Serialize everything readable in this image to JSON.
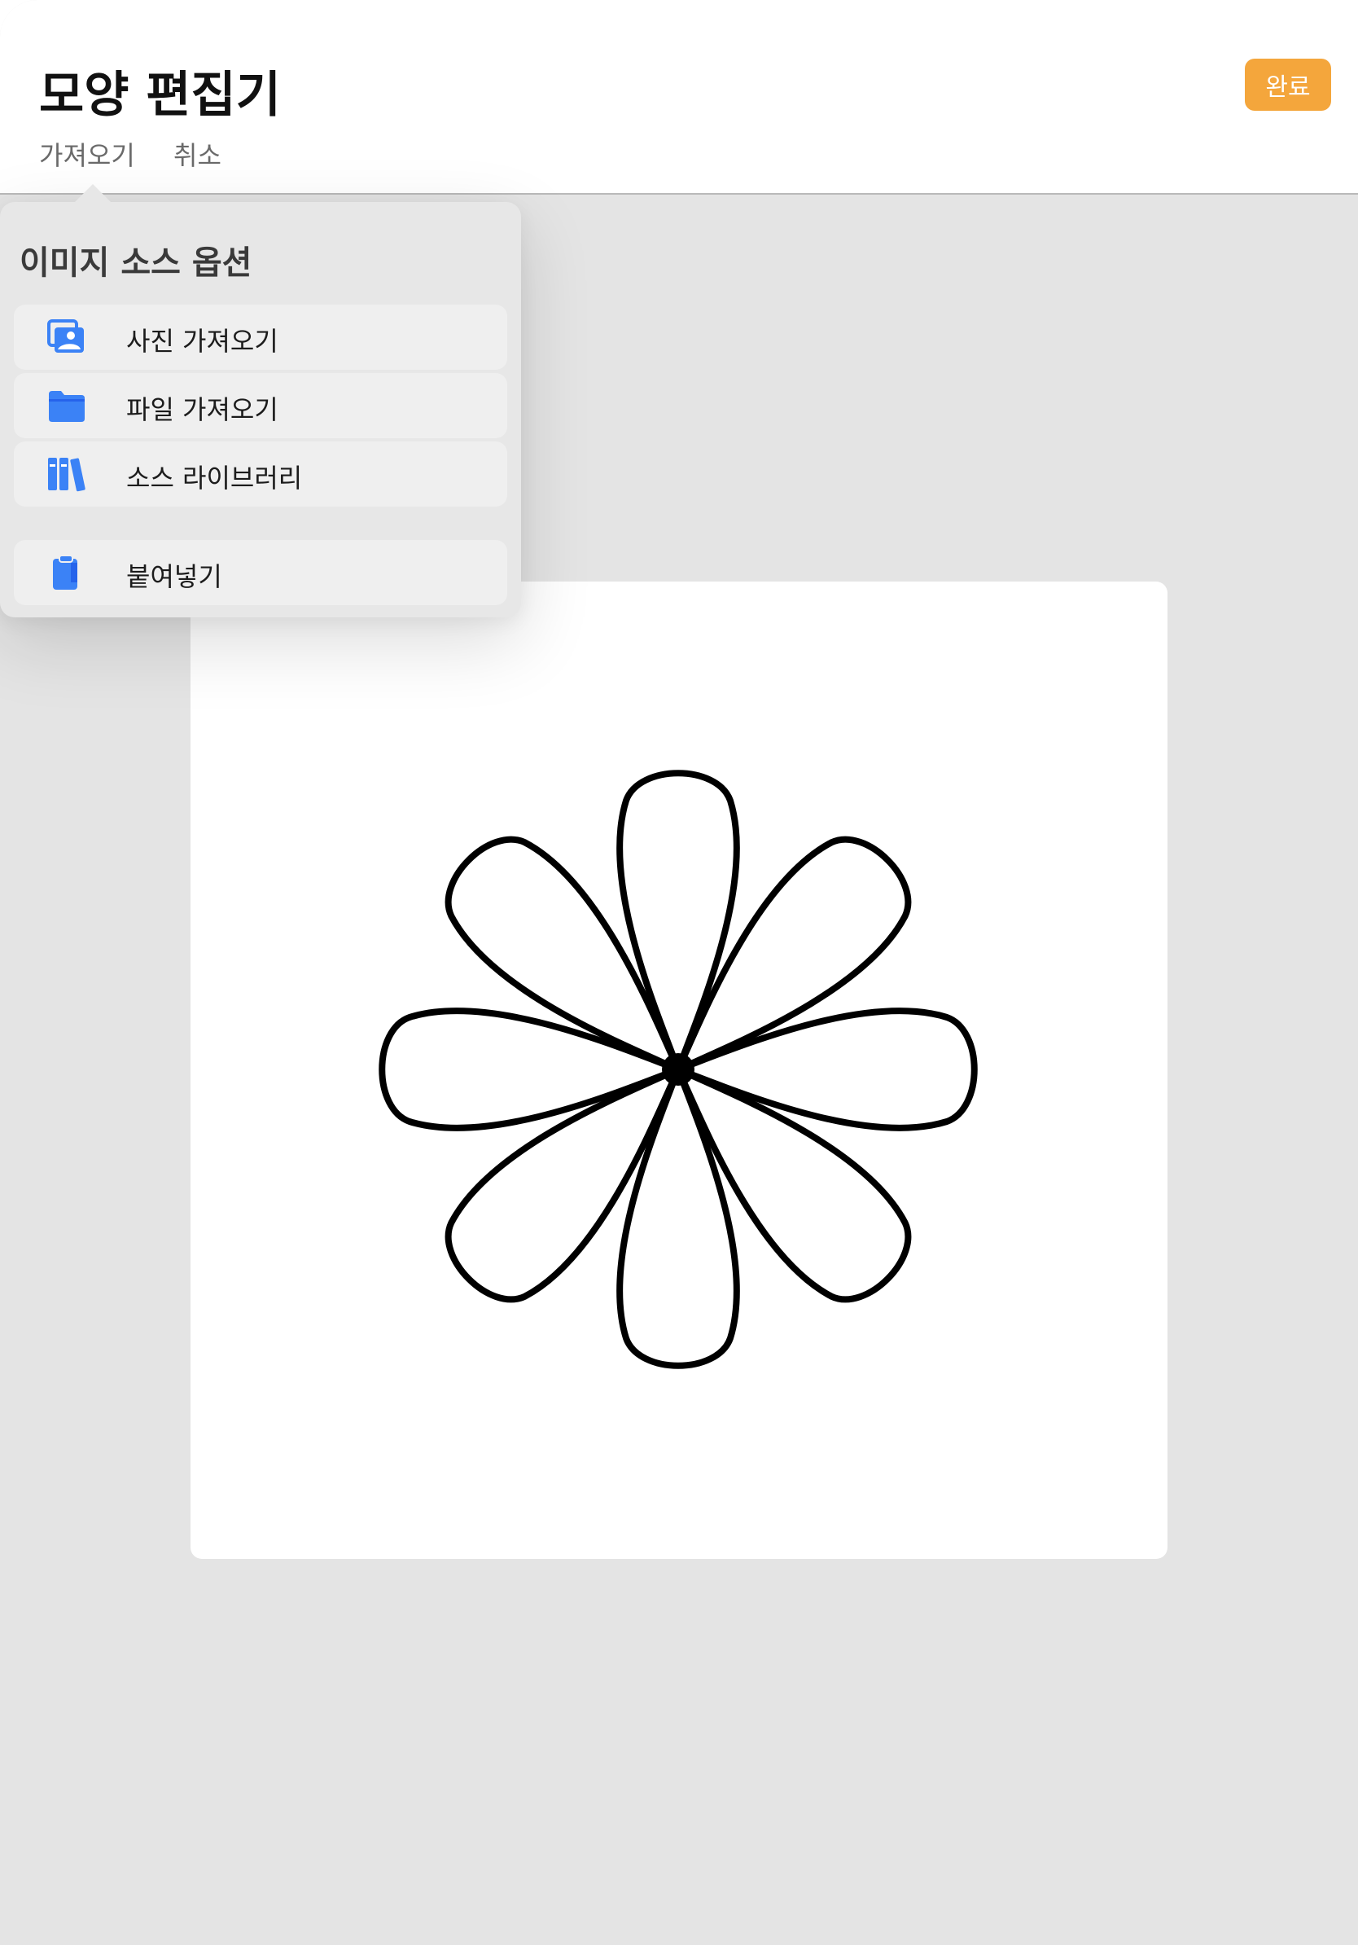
{
  "header": {
    "title": "모양 편집기",
    "import_label": "가져오기",
    "cancel_label": "취소",
    "done_label": "완료"
  },
  "popover": {
    "title": "이미지 소스 옵션",
    "items": [
      {
        "label": "사진 가져오기",
        "icon": "photo-icon"
      },
      {
        "label": "파일 가져오기",
        "icon": "folder-icon"
      },
      {
        "label": "소스 라이브러리",
        "icon": "books-icon"
      },
      {
        "label": "붙여넣기",
        "icon": "clipboard-icon"
      }
    ]
  },
  "colors": {
    "accent": "#f4a63c",
    "icon_blue": "#3b82f6",
    "background": "#e4e4e4",
    "canvas": "#ffffff"
  },
  "canvas": {
    "shape": "eight-petal-flower-outline",
    "petal_count": 8
  }
}
